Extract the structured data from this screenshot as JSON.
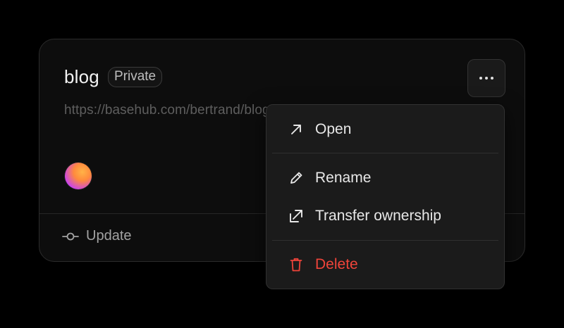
{
  "card": {
    "title": "blog",
    "visibility_badge": "Private",
    "url": "https://basehub.com/bertrand/blog",
    "footer_label": "Update"
  },
  "menu": {
    "items": [
      {
        "label": "Open",
        "icon": "arrow-up-right-icon"
      },
      {
        "label": "Rename",
        "icon": "pencil-icon"
      },
      {
        "label": "Transfer ownership",
        "icon": "transfer-icon"
      },
      {
        "label": "Delete",
        "icon": "trash-icon",
        "danger": true
      }
    ]
  },
  "colors": {
    "background": "#000000",
    "card": "#0d0d0d",
    "menu": "#1b1b1b",
    "danger": "#f0443a"
  }
}
